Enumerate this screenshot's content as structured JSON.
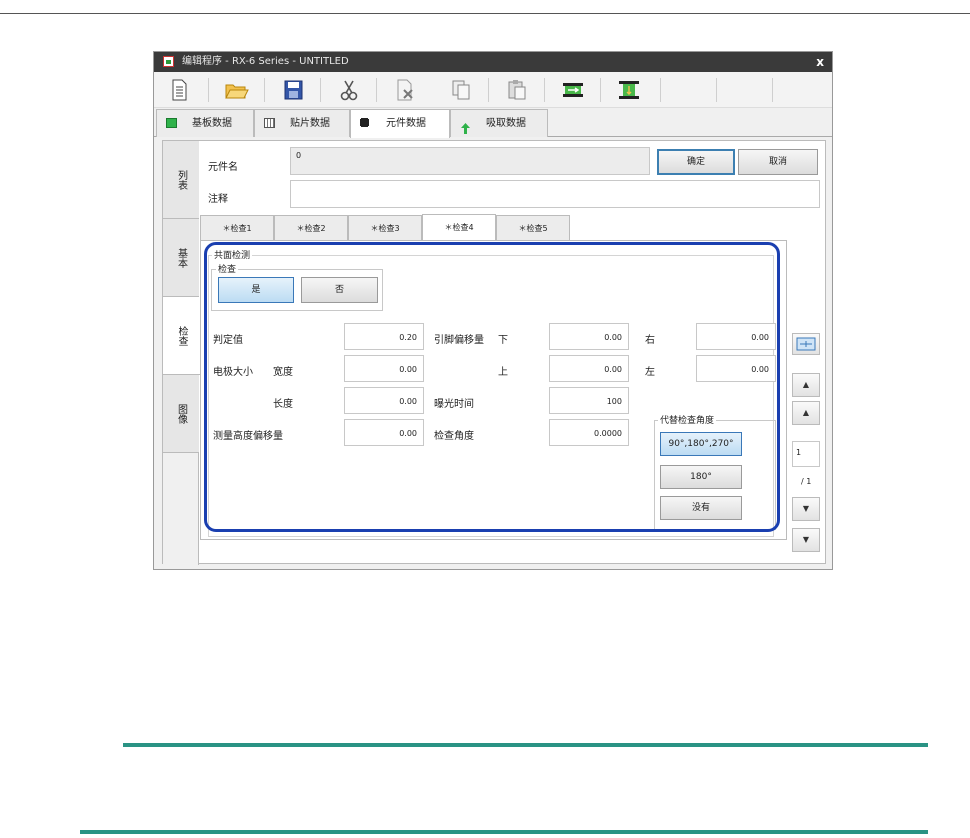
{
  "window": {
    "title": "编辑程序 - RX-6 Series - UNTITLED",
    "close": "x"
  },
  "toolbar": {
    "icons": [
      "new-file-icon",
      "open-folder-icon",
      "save-icon",
      "cut-icon",
      "delete-icon",
      "copy-icon",
      "paste-icon",
      "transfer-icon",
      "align-icon"
    ]
  },
  "main_tabs": [
    {
      "label": "基板数据",
      "icon": "board-icon"
    },
    {
      "label": "贴片数据",
      "icon": "grid-icon"
    },
    {
      "label": "元件数据",
      "icon": "chip-icon",
      "active": true
    },
    {
      "label": "吸取数据",
      "icon": "pickup-icon"
    }
  ],
  "vertical_tabs": [
    {
      "label": "列表"
    },
    {
      "label": "基本"
    },
    {
      "label": "检查",
      "active": true
    },
    {
      "label": "图像"
    }
  ],
  "form": {
    "component_name_label": "元件名",
    "component_name_value": "0",
    "comment_label": "注释",
    "comment_value": "",
    "ok_label": "确定",
    "cancel_label": "取消"
  },
  "sub_tabs": [
    {
      "label": "＊检查1"
    },
    {
      "label": "＊检查2"
    },
    {
      "label": "＊检查3"
    },
    {
      "label": "＊检查4",
      "active": true
    },
    {
      "label": "＊检查5"
    }
  ],
  "coplanarity": {
    "group_title": "共面检测",
    "check_title": "检查",
    "yes_label": "是",
    "no_label": "否",
    "judgment_label": "判定值",
    "judgment_value": "0.20",
    "lead_offset_label": "引脚偏移量",
    "down_label": "下",
    "down_value": "0.00",
    "right_label": "右",
    "right_value": "0.00",
    "electrode_size_label": "电极大小",
    "width_label": "宽度",
    "width_value": "0.00",
    "up_label": "上",
    "up_value": "0.00",
    "left_label": "左",
    "left_value": "0.00",
    "length_label": "长度",
    "length_value": "0.00",
    "exposure_label": "曝光时间",
    "exposure_value": "100",
    "height_offset_label": "测量高度偏移量",
    "height_offset_value": "0.00",
    "check_angle_label": "检查角度",
    "check_angle_value": "0.0000",
    "alt_angle_title": "代替检查角度",
    "alt_angle_1": "90°,180°,270°",
    "alt_angle_2": "180°",
    "alt_angle_3": "没有"
  },
  "side_controls": {
    "page_value": "1",
    "page_total": "/ 1"
  },
  "colors": {
    "highlight": "#1a3fb0",
    "rule": "#2a9384",
    "title_bar": "#3a3a3a"
  }
}
